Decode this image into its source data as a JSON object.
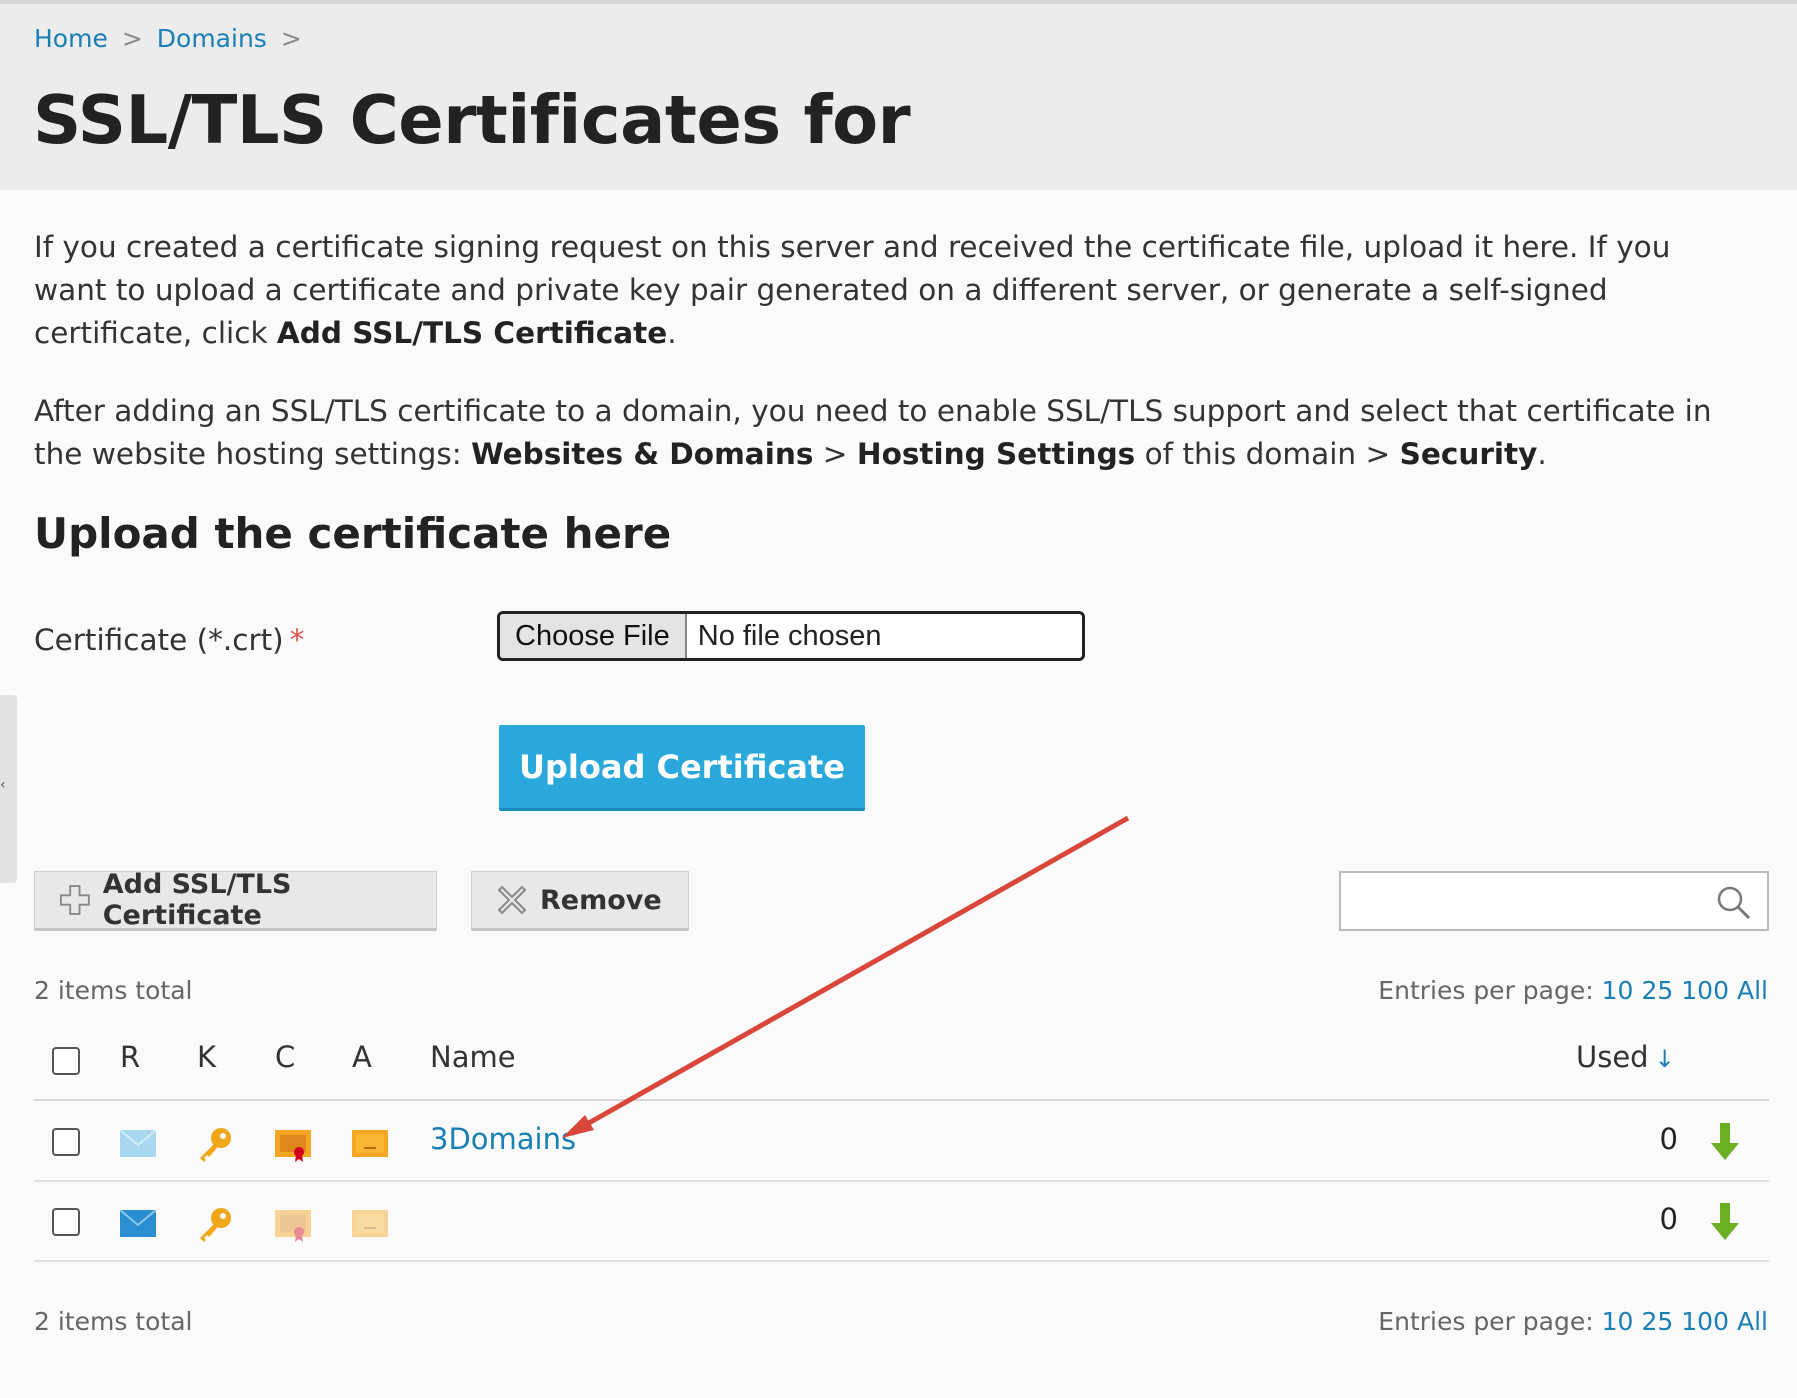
{
  "breadcrumb": {
    "home": "Home",
    "domains": "Domains",
    "sep": ">"
  },
  "page": {
    "title": "SSL/TLS Certificates for"
  },
  "intro": {
    "p1_text_a": "If you created a certificate signing request on this server and received the certificate file, upload it here. If you want to upload a certificate and private key pair generated on a different server, or generate a self-signed certificate, click ",
    "p1_bold": "Add SSL/TLS Certificate",
    "p1_text_b": ".",
    "p2_text_a": "After adding an SSL/TLS certificate to a domain, you need to enable SSL/TLS support and select that certificate in the website hosting settings: ",
    "p2_bold_1": "Websites & Domains",
    "p2_sep_1": " > ",
    "p2_bold_2": "Hosting Settings",
    "p2_text_b": " of this domain > ",
    "p2_bold_3": "Security",
    "p2_text_c": "."
  },
  "upload": {
    "section_title": "Upload the certificate here",
    "certificate_label": "Certificate (*.crt)",
    "required_mark": "*",
    "choose_file_label": "Choose File",
    "file_status": "No file chosen",
    "upload_button": "Upload Certificate"
  },
  "toolbar": {
    "add_label": "Add SSL/TLS Certificate",
    "remove_label": "Remove",
    "search_value": ""
  },
  "list": {
    "total_text": "2 items total",
    "entries_label": "Entries per page:",
    "page_sizes": [
      "10",
      "25",
      "100",
      "All"
    ],
    "columns": {
      "r": "R",
      "k": "K",
      "c": "C",
      "a": "A",
      "name": "Name",
      "used": "Used",
      "sort_arrow": "↓"
    },
    "rows": [
      {
        "name": "3Domains",
        "used": "0",
        "faded": false
      },
      {
        "name": "",
        "used": "0",
        "faded": true
      }
    ]
  },
  "colors": {
    "accent": "#1a7fb5",
    "primary_button": "#2aa8dc",
    "download_arrow": "#6ab023",
    "annotation_arrow": "#d9473a"
  },
  "icons": {
    "r": "mail-icon",
    "k": "key-icon",
    "c": "certificate-icon",
    "a": "ca-certificate-icon",
    "download": "download-arrow-icon",
    "search": "search-icon",
    "add": "plus-icon",
    "remove": "remove-x-icon"
  }
}
